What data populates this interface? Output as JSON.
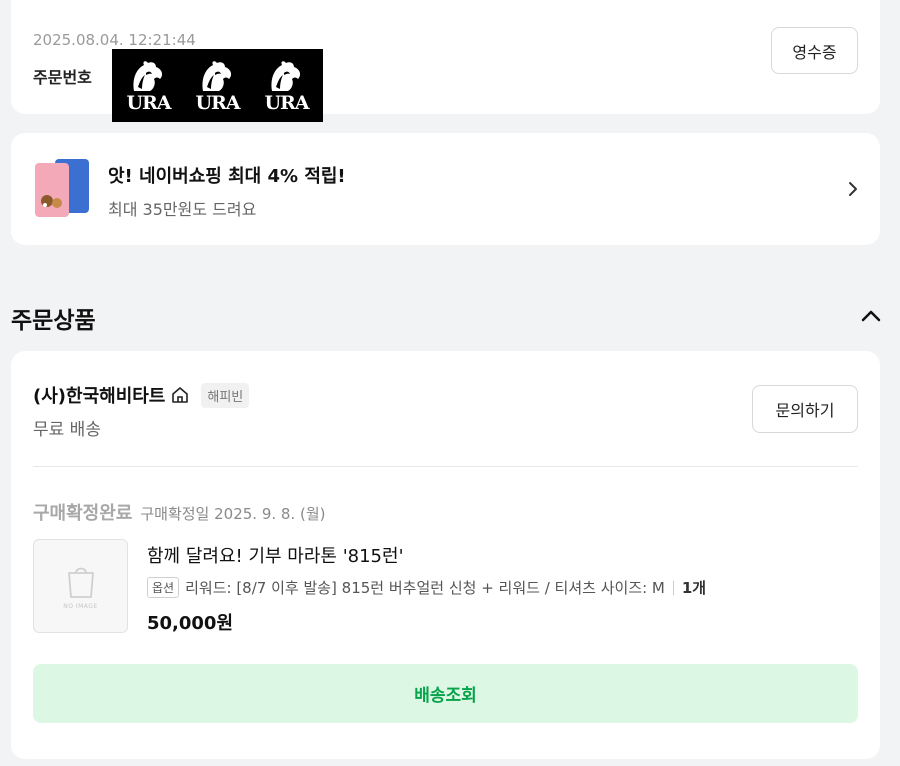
{
  "order": {
    "datetime": "2025.08.04. 12:21:44",
    "number_label": "주문번호",
    "redacted_logo_text": "URA",
    "receipt_button": "영수증"
  },
  "promo": {
    "title": "앗! 네이버쇼핑 최대 4% 적립!",
    "subtitle": "최대 35만원도 드려요",
    "icon": "credit-cards-image"
  },
  "section": {
    "title": "주문상품"
  },
  "seller": {
    "name": "(사)한국해비타트",
    "store_icon": "store-icon",
    "carrier": "해피빈",
    "shipping": "무료 배송",
    "inquiry_button": "문의하기"
  },
  "item": {
    "status": "구매확정완료",
    "confirm_date": "구매확정일 2025. 9. 8. (월)",
    "thumbnail_caption": "NO IMAGE",
    "name": "함께 달려요! 기부 마라톤 '815런'",
    "option_badge": "옵션",
    "option_text": "리워드: [8/7 이후 발송] 815런 버추얼런 신청 + 리워드 / 티셔츠 사이즈: M",
    "quantity": "1개",
    "price": "50,000원",
    "track_button": "배송조회"
  },
  "colors": {
    "accent_green": "#06a34a",
    "track_bg": "#dcf7e3",
    "page_bg": "#f2f3f5"
  }
}
